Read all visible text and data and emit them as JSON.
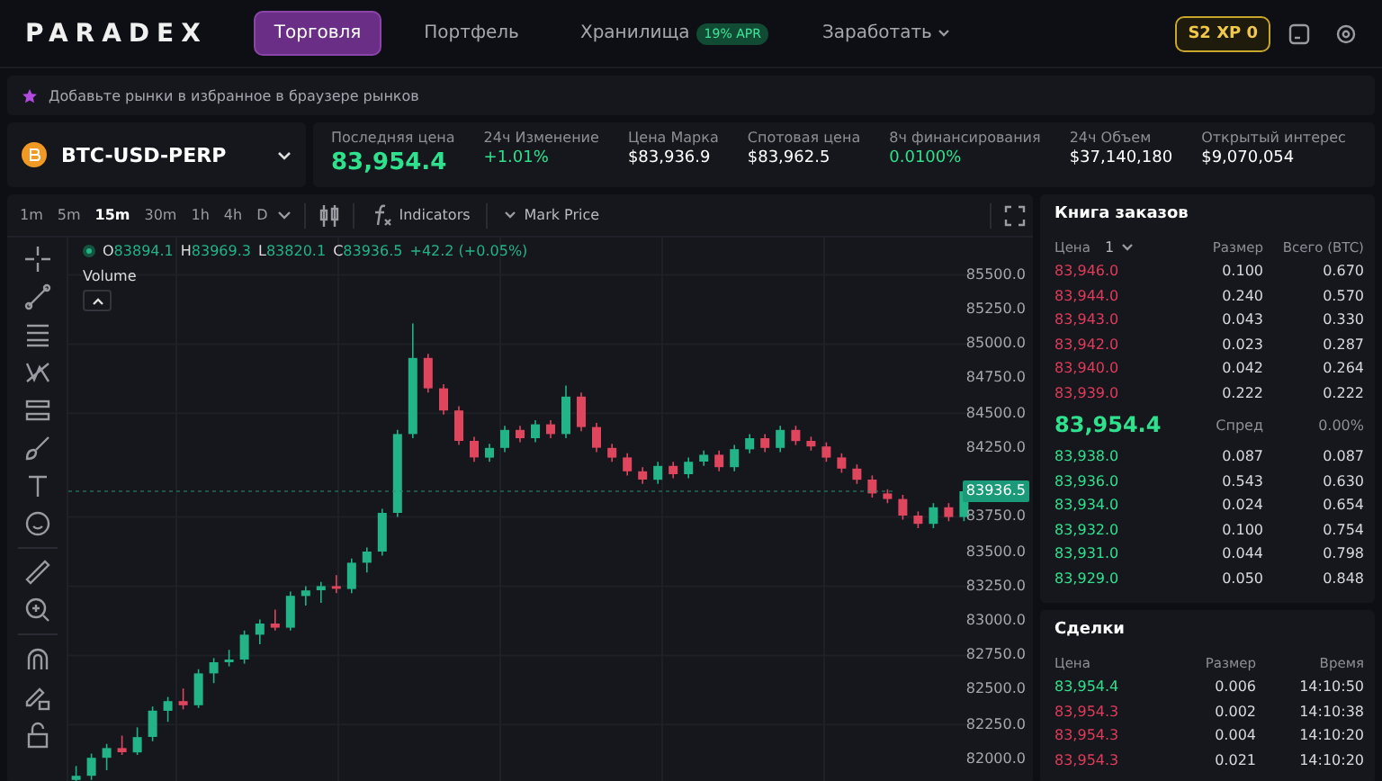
{
  "nav": {
    "logo": "PARADEX",
    "tabs": [
      {
        "label": "Торговля",
        "selected": true
      },
      {
        "label": "Портфель",
        "selected": false
      },
      {
        "label": "Хранилища",
        "selected": false,
        "badge": "19% APR"
      }
    ],
    "menu": "Заработать",
    "xp": {
      "season": "S2",
      "label": "XP",
      "value": "0"
    }
  },
  "banner": "Добавьте рынки в избранное в браузере рынков",
  "market": {
    "symbol": "BTC-USD-PERP",
    "stats": [
      {
        "label": "Последняя цена",
        "value": "83,954.4",
        "kind": "big"
      },
      {
        "label": "24ч Изменение",
        "value": "+1.01%",
        "kind": "up"
      },
      {
        "label": "Цена Марка",
        "value": "$83,936.9",
        "kind": "plain"
      },
      {
        "label": "Спотовая цена",
        "value": "$83,962.5",
        "kind": "plain"
      },
      {
        "label": "8ч финансирования",
        "value": "0.0100%",
        "kind": "up"
      },
      {
        "label": "24ч Объем",
        "value": "$37,140,180",
        "kind": "plain"
      },
      {
        "label": "Открытый интерес",
        "value": "$9,070,054",
        "kind": "plain"
      }
    ]
  },
  "chart": {
    "intervals": [
      {
        "label": "1m",
        "selected": false
      },
      {
        "label": "5m",
        "selected": false
      },
      {
        "label": "15m",
        "selected": true
      },
      {
        "label": "30m",
        "selected": false
      },
      {
        "label": "1h",
        "selected": false
      },
      {
        "label": "4h",
        "selected": false
      },
      {
        "label": "D",
        "selected": false
      }
    ],
    "indicators": "Indicators",
    "price_type": "Mark Price",
    "legend": [
      {
        "label": "O",
        "value": "83894.1"
      },
      {
        "label": "H",
        "value": "83969.3"
      },
      {
        "label": "L",
        "value": "83820.1"
      },
      {
        "label": "C",
        "value": "83936.5"
      }
    ],
    "change": "+42.2 (+0.05%)",
    "volume": "Volume",
    "last_price": "83936.5",
    "chart_data": {
      "type": "candlestick",
      "grid": true,
      "ylim": [
        81790,
        85770
      ],
      "ref_lines": [
        {
          "axis": "y",
          "value": 83936.5
        }
      ],
      "yticks": [
        {
          "value": 85500,
          "label": "85500.0"
        },
        {
          "value": 85250,
          "label": "85250.0"
        },
        {
          "value": 85000,
          "label": "85000.0"
        },
        {
          "value": 84750,
          "label": "84750.0"
        },
        {
          "value": 84500,
          "label": "84500.0"
        },
        {
          "value": 84250,
          "label": "84250.0"
        },
        {
          "value": 83750,
          "label": "83750.0"
        },
        {
          "value": 83500,
          "label": "83500.0"
        },
        {
          "value": 83250,
          "label": "83250.0"
        },
        {
          "value": 83000,
          "label": "83000.0"
        },
        {
          "value": 82750,
          "label": "82750.0"
        },
        {
          "value": 82500,
          "label": "82500.0"
        },
        {
          "value": 82250,
          "label": "82250.0"
        },
        {
          "value": 82000,
          "label": "82000.0"
        }
      ],
      "ohlc": [
        [
          81850,
          81950,
          81820,
          81880
        ],
        [
          81880,
          82040,
          81850,
          82010
        ],
        [
          82010,
          82110,
          81920,
          82080
        ],
        [
          82080,
          82170,
          82030,
          82050
        ],
        [
          82050,
          82230,
          82030,
          82160
        ],
        [
          82160,
          82380,
          82130,
          82350
        ],
        [
          82350,
          82450,
          82270,
          82420
        ],
        [
          82420,
          82510,
          82360,
          82390
        ],
        [
          82390,
          82650,
          82370,
          82620
        ],
        [
          82620,
          82730,
          82550,
          82700
        ],
        [
          82700,
          82790,
          82670,
          82720
        ],
        [
          82720,
          82930,
          82690,
          82900
        ],
        [
          82900,
          83010,
          82830,
          82980
        ],
        [
          82980,
          83080,
          82930,
          82950
        ],
        [
          82950,
          83210,
          82930,
          83180
        ],
        [
          83180,
          83250,
          83110,
          83220
        ],
        [
          83220,
          83280,
          83130,
          83250
        ],
        [
          83250,
          83330,
          83200,
          83230
        ],
        [
          83230,
          83450,
          83200,
          83420
        ],
        [
          83420,
          83530,
          83350,
          83500
        ],
        [
          83500,
          83810,
          83470,
          83780
        ],
        [
          83780,
          84380,
          83750,
          84350
        ],
        [
          84350,
          85150,
          84320,
          84900
        ],
        [
          84900,
          84930,
          84650,
          84680
        ],
        [
          84680,
          84710,
          84490,
          84520
        ],
        [
          84520,
          84550,
          84270,
          84300
        ],
        [
          84300,
          84330,
          84150,
          84180
        ],
        [
          84180,
          84280,
          84150,
          84250
        ],
        [
          84250,
          84410,
          84220,
          84380
        ],
        [
          84380,
          84410,
          84290,
          84320
        ],
        [
          84320,
          84450,
          84290,
          84420
        ],
        [
          84420,
          84450,
          84320,
          84350
        ],
        [
          84350,
          84700,
          84320,
          84620
        ],
        [
          84620,
          84650,
          84370,
          84400
        ],
        [
          84400,
          84430,
          84220,
          84250
        ],
        [
          84250,
          84280,
          84150,
          84180
        ],
        [
          84180,
          84210,
          84050,
          84080
        ],
        [
          84080,
          84110,
          83990,
          84020
        ],
        [
          84020,
          84150,
          83990,
          84120
        ],
        [
          84120,
          84150,
          84030,
          84060
        ],
        [
          84060,
          84180,
          84030,
          84150
        ],
        [
          84150,
          84230,
          84120,
          84200
        ],
        [
          84200,
          84230,
          84080,
          84110
        ],
        [
          84110,
          84270,
          84080,
          84240
        ],
        [
          84240,
          84350,
          84210,
          84320
        ],
        [
          84320,
          84350,
          84220,
          84250
        ],
        [
          84250,
          84410,
          84220,
          84380
        ],
        [
          84380,
          84410,
          84270,
          84300
        ],
        [
          84300,
          84330,
          84230,
          84260
        ],
        [
          84260,
          84290,
          84150,
          84180
        ],
        [
          84180,
          84210,
          84070,
          84100
        ],
        [
          84100,
          84130,
          83990,
          84020
        ],
        [
          84020,
          84050,
          83890,
          83920
        ],
        [
          83920,
          83950,
          83850,
          83880
        ],
        [
          83880,
          83910,
          83730,
          83760
        ],
        [
          83760,
          83790,
          83670,
          83700
        ],
        [
          83700,
          83850,
          83670,
          83820
        ],
        [
          83820,
          83850,
          83720,
          83750
        ],
        [
          83750,
          83969.3,
          83720,
          83936.5
        ]
      ]
    }
  },
  "order_book": {
    "title": "Книга заказов",
    "columns": [
      "Цена",
      "Размер",
      "Всего (BTC)"
    ],
    "grouping": "1",
    "asks": [
      {
        "price": "83,946.0",
        "size": "0.100",
        "total": "0.670"
      },
      {
        "price": "83,944.0",
        "size": "0.240",
        "total": "0.570"
      },
      {
        "price": "83,943.0",
        "size": "0.043",
        "total": "0.330"
      },
      {
        "price": "83,942.0",
        "size": "0.023",
        "total": "0.287"
      },
      {
        "price": "83,940.0",
        "size": "0.042",
        "total": "0.264"
      },
      {
        "price": "83,939.0",
        "size": "0.222",
        "total": "0.222"
      }
    ],
    "last": "83,954.4",
    "spread_label": "Спред",
    "spread": "0.00%",
    "bids": [
      {
        "price": "83,938.0",
        "size": "0.087",
        "total": "0.087"
      },
      {
        "price": "83,936.0",
        "size": "0.543",
        "total": "0.630"
      },
      {
        "price": "83,934.0",
        "size": "0.024",
        "total": "0.654"
      },
      {
        "price": "83,932.0",
        "size": "0.100",
        "total": "0.754"
      },
      {
        "price": "83,931.0",
        "size": "0.044",
        "total": "0.798"
      },
      {
        "price": "83,929.0",
        "size": "0.050",
        "total": "0.848"
      }
    ]
  },
  "trades": {
    "title": "Сделки",
    "columns": [
      "Цена",
      "Размер",
      "Время"
    ],
    "rows": [
      {
        "price": "83,954.4",
        "size": "0.006",
        "time": "14:10:50",
        "color": "#2fe08d"
      },
      {
        "price": "83,954.3",
        "size": "0.002",
        "time": "14:10:38",
        "color": "#e03b5a"
      },
      {
        "price": "83,954.3",
        "size": "0.004",
        "time": "14:10:20",
        "color": "#e03b5a"
      },
      {
        "price": "83,954.3",
        "size": "0.021",
        "time": "14:10:20",
        "color": "#e03b5a"
      }
    ]
  }
}
